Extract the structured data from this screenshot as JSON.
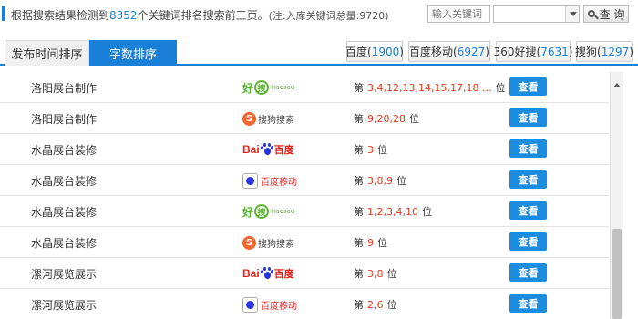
{
  "summary": {
    "prefix": "根据搜索结果检测到",
    "count": "8352",
    "suffix": "个关键词排名搜索前三页。",
    "note": "(注:入库关键词总量:9720)"
  },
  "search": {
    "placeholder": "输入关键词",
    "select_value": "",
    "query_label": "查 询"
  },
  "tabs": [
    {
      "label": "发布时间排序",
      "active": false
    },
    {
      "label": "字数排序",
      "active": true
    }
  ],
  "engines": [
    {
      "name": "百度",
      "count": "1900"
    },
    {
      "name": "百度移动",
      "count": "6927"
    },
    {
      "name": "360好搜",
      "count": "7631"
    },
    {
      "name": "搜狗",
      "count": "1297"
    }
  ],
  "rank_prefix": "第",
  "rank_suffix": "位",
  "view_label": "查看",
  "logos": {
    "haosou": {
      "hao": "好",
      "sou": "搜",
      "text": "Haosou"
    },
    "sogou": {
      "s": "S",
      "text": "搜狗搜索"
    },
    "baidu": {
      "b1": "Bai",
      "text": "百度"
    },
    "baidu_mobile": {
      "text": "百度移动"
    }
  },
  "rows": [
    {
      "keyword": "洛阳展台制作",
      "engine": "haosou",
      "ranks": "3,4,12,13,14,15,17,18 ..."
    },
    {
      "keyword": "洛阳展台制作",
      "engine": "sogou",
      "ranks": "9,20,28"
    },
    {
      "keyword": "水晶展台装修",
      "engine": "baidu",
      "ranks": "3"
    },
    {
      "keyword": "水晶展台装修",
      "engine": "baidu_mobile",
      "ranks": "3,8,9"
    },
    {
      "keyword": "水晶展台装修",
      "engine": "haosou",
      "ranks": "1,2,3,4,10"
    },
    {
      "keyword": "水晶展台装修",
      "engine": "sogou",
      "ranks": "9"
    },
    {
      "keyword": "漯河展览展示",
      "engine": "baidu",
      "ranks": "3,8"
    },
    {
      "keyword": "漯河展览展示",
      "engine": "baidu_mobile",
      "ranks": "2,6"
    }
  ],
  "colors": {
    "accent": "#1a7fd6",
    "rank_numbers": "#e03a1e",
    "view_button": "#1a8de0"
  }
}
